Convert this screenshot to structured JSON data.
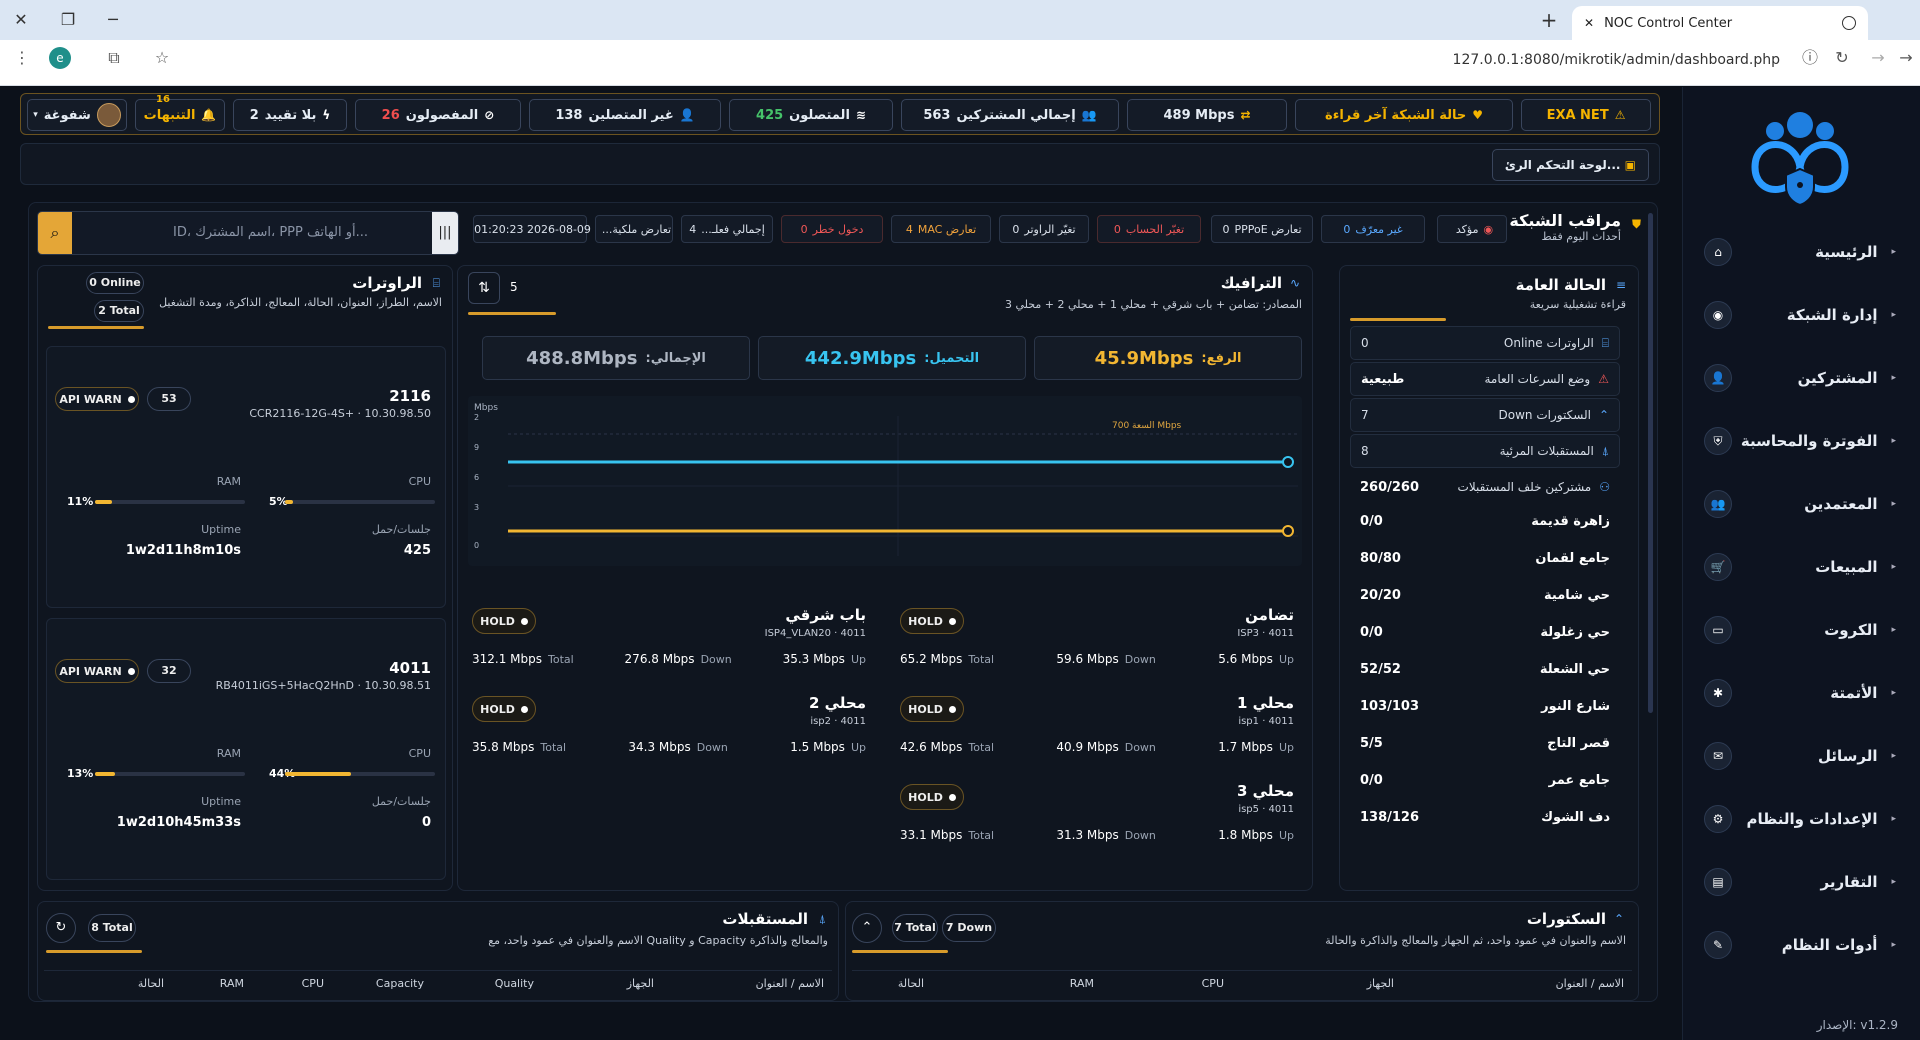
{
  "browser": {
    "tab_title": "NOC Control Center",
    "url": "127.0.0.1:8080/mikrotik/admin/dashboard.php"
  },
  "topbar": {
    "brand": "EXA NET",
    "network_state": "حالة الشبكة آخر قراءة",
    "throughput": "489 Mbps",
    "total_subscribers_label": "إجمالي المشتركين",
    "total_subscribers": "563",
    "online_label": "المتصلون",
    "online": "425",
    "offline_label": "غير المتصلين",
    "offline": "138",
    "disconnected_label": "المفصولون",
    "disconnected": "26",
    "unlimited_label": "بلا تقييد",
    "unlimited": "2",
    "alerts_label": "التنبهات",
    "alerts_count": "16",
    "user_label": "شفوغة"
  },
  "crumb": "لوحة التحكم الرئ...",
  "monitor": {
    "title": "مراقب الشبكة",
    "subtitle": "أحداث اليوم فقط",
    "chips": [
      {
        "label": "مؤكد",
        "value": ""
      },
      {
        "label": "غير معرّف",
        "value": "0"
      },
      {
        "label": "تعارض PPPoE",
        "value": "0"
      },
      {
        "label": "تغيّر الحساب",
        "value": "0"
      },
      {
        "label": "تغيّر الراوتر",
        "value": "0"
      },
      {
        "label": "تعارض MAC",
        "value": "4"
      },
      {
        "label": "دخول خطر",
        "value": "0"
      },
      {
        "label": "إجمالي فعلـ...",
        "value": "4"
      },
      {
        "label": "تعارض ملكية...",
        "value": ""
      },
      {
        "label": "2026-08-09 01:20:23",
        "value": ""
      }
    ],
    "search_placeholder": "ID، اسم المشترك، PPP أو الهاتف..."
  },
  "status": {
    "title": "الحالة العامة",
    "subtitle": "قراءة تشغيلية سريعة",
    "rows": [
      {
        "label": "الراوترات Online",
        "value": "0"
      },
      {
        "label": "وضع السرعات العامة",
        "value": "طبيعية"
      },
      {
        "label": "السكتورات Down",
        "value": "7"
      },
      {
        "label": "المستقبلات المرئية",
        "value": "8"
      },
      {
        "label": "مشتركين خلف المستقبلات",
        "value": "260/260"
      }
    ],
    "zones": [
      {
        "label": "زاهرة قديمة",
        "value": "0/0"
      },
      {
        "label": "جامع لقمان",
        "value": "80/80"
      },
      {
        "label": "حي شامية",
        "value": "20/20"
      },
      {
        "label": "حي زغلولة",
        "value": "0/0"
      },
      {
        "label": "حي الشعلة",
        "value": "52/52"
      },
      {
        "label": "شارع النور",
        "value": "103/103"
      },
      {
        "label": "قصر التاج",
        "value": "5/5"
      },
      {
        "label": "جامع عمر",
        "value": "0/0"
      },
      {
        "label": "دف الشوك",
        "value": "138/126"
      }
    ]
  },
  "traffic": {
    "title": "الترافيك",
    "subtitle": "المصادر: تضامن + باب شرقي + محلي 1 + محلي 2 + محلي 3",
    "count": "5",
    "upload_label": "الرفع:",
    "upload": "45.9Mbps",
    "download_label": "التحميل:",
    "download": "442.9Mbps",
    "total_label": "الإجمالي:",
    "total": "488.8Mbps",
    "capacity_label": "السعة 700 Mbps",
    "axis_unit": "Mbps",
    "interfaces": [
      {
        "name": "تضامن",
        "meta": "ISP3 · 4011",
        "hold": "HOLD",
        "up": "5.6 Mbps",
        "down": "59.6 Mbps",
        "total": "65.2 Mbps"
      },
      {
        "name": "باب شرقي",
        "meta": "ISP4_VLAN20 · 4011",
        "hold": "HOLD",
        "up": "35.3 Mbps",
        "down": "276.8 Mbps",
        "total": "312.1 Mbps"
      },
      {
        "name": "محلي 1",
        "meta": "isp1 · 4011",
        "hold": "HOLD",
        "up": "1.7 Mbps",
        "down": "40.9 Mbps",
        "total": "42.6 Mbps"
      },
      {
        "name": "محلي 2",
        "meta": "isp2 · 4011",
        "hold": "HOLD",
        "up": "1.5 Mbps",
        "down": "34.3 Mbps",
        "total": "35.8 Mbps"
      },
      {
        "name": "محلي 3",
        "meta": "isp5 · 4011",
        "hold": "HOLD",
        "up": "1.8 Mbps",
        "down": "31.3 Mbps",
        "total": "33.1 Mbps"
      }
    ],
    "labels": {
      "up": "Up",
      "down": "Down",
      "total": "Total"
    }
  },
  "routers": {
    "title": "الراوترات",
    "subtitle": "الاسم، الطراز، العنوان، الحالة، المعالج، الذاكرة، ومدة التشغيل",
    "online_label": "Online",
    "online": "0",
    "total_label": "Total",
    "total": "2",
    "labels": {
      "cpu": "CPU",
      "ram": "RAM",
      "sessions": "جلسات/حمل",
      "uptime": "Uptime"
    },
    "items": [
      {
        "name": "2116",
        "model": "CCR2116-12G-4S+ · 10.30.98.50",
        "warn": "API WARN",
        "count": "53",
        "cpu_pct": "5%",
        "cpu": 0.05,
        "ram_pct": "11%",
        "ram": 0.11,
        "sessions": "425",
        "uptime": "1w2d11h8m10s"
      },
      {
        "name": "4011",
        "model": "RB4011iGS+5HacQ2HnD · 10.30.98.51",
        "warn": "API WARN",
        "count": "32",
        "cpu_pct": "44%",
        "cpu": 0.44,
        "ram_pct": "13%",
        "ram": 0.13,
        "sessions": "0",
        "uptime": "1w2d10h45m33s"
      }
    ]
  },
  "sectors": {
    "title": "السكتورات",
    "subtitle": "الاسم والعنوان في عمود واحد، ثم الجهاز والمعالج والذاكرة والحالة",
    "down": "7 Down",
    "total": "7 Total",
    "columns": [
      "الاسم / العنوان",
      "الجهاز",
      "CPU",
      "RAM",
      "الحالة"
    ]
  },
  "receivers": {
    "title": "المستقبلات",
    "subtitle": "الاسم والعنوان في عمود واحد، مع Quality و Capacity والمعالج والذاكرة",
    "total": "8 Total",
    "columns": [
      "الاسم / العنوان",
      "الجهاز",
      "Quality",
      "Capacity",
      "CPU",
      "RAM",
      "الحالة"
    ]
  },
  "sidebar": {
    "items": [
      "الرئيسية",
      "إدارة الشبكة",
      "المشتركين",
      "الفوترة والمحاسبة",
      "المعتمدين",
      "المبيعات",
      "الكروت",
      "الأتمتة",
      "الرسائل",
      "الإعدادات والنظام",
      "التقارير",
      "أدوات النظام"
    ],
    "version": "الإصدار: v1.2.9"
  }
}
